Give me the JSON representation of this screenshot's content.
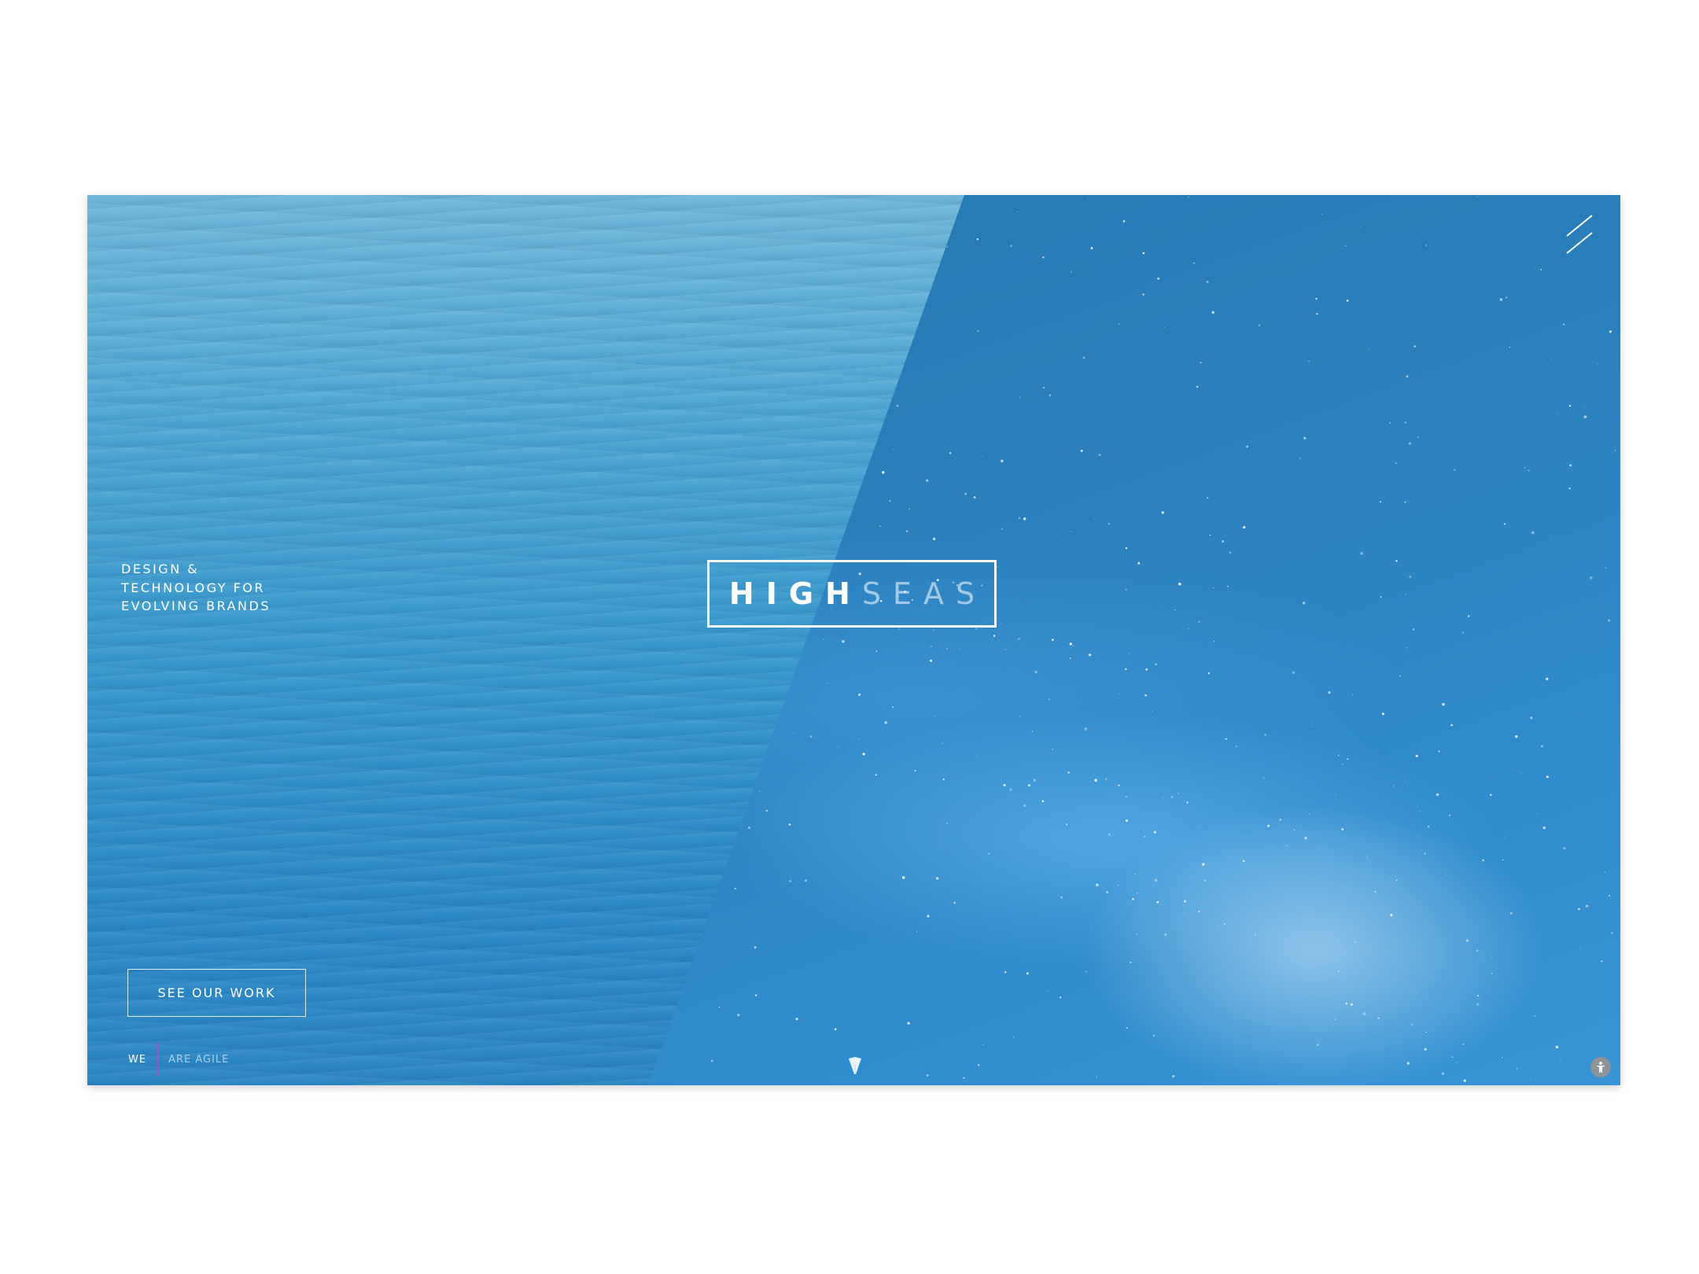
{
  "brand": {
    "logo_part1": "HIGH",
    "logo_part2": "SEAS"
  },
  "hero": {
    "tagline": "Design & Technology for Evolving Brands",
    "cta_label": "SEE OUR WORK"
  },
  "ticker": {
    "lead": "WE",
    "rotating_word": "ARE AGILE"
  },
  "icons": {
    "menu": "menu-slashes-icon",
    "scroll": "scroll-down-arrow-icon",
    "corner": "accessibility-icon"
  },
  "colors": {
    "ocean": "#3597cc",
    "space": "#2a7fbb",
    "accent_divider": "#b04bbf"
  }
}
